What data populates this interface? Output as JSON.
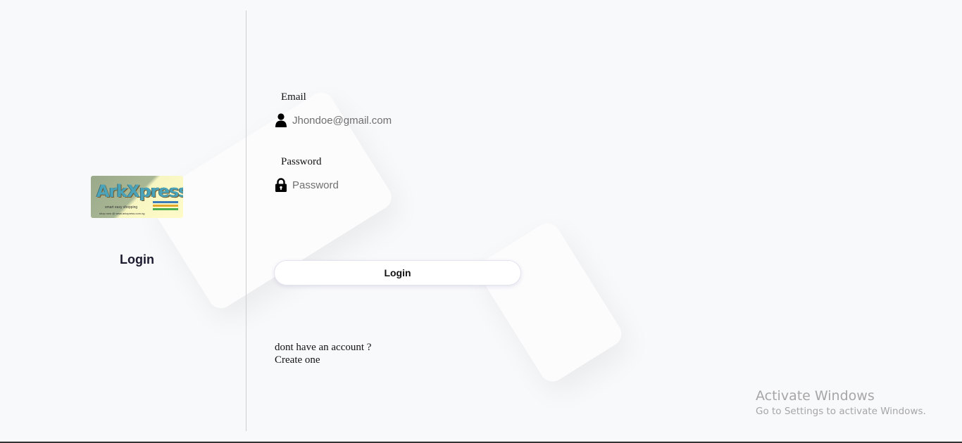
{
  "brand": {
    "logo_text": "ArkXpress",
    "logo_tagline": "smart easy shopping",
    "logo_url_text": "shop now @ www.arkxpress.com.ng"
  },
  "sidebar": {
    "title": "Login"
  },
  "form": {
    "email": {
      "label": "Email",
      "placeholder": "Jhondoe@gmail.com",
      "icon": "user-icon"
    },
    "password": {
      "label": "Password",
      "placeholder": "Password",
      "icon": "lock-icon"
    },
    "submit_label": "Login"
  },
  "signup": {
    "prompt": "dont have an account ?",
    "link": "Create one"
  },
  "watermark": {
    "title": "Activate Windows",
    "subtitle": "Go to Settings to activate Windows."
  },
  "colors": {
    "background": "#f8f9fa",
    "title_text": "#1b1b2f",
    "watermark": "#a6a6a6"
  }
}
